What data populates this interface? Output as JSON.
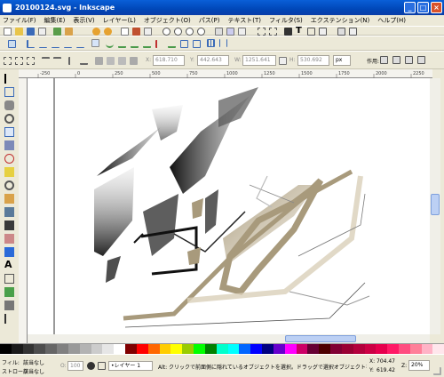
{
  "window": {
    "title": "20100124.svg - Inkscape",
    "buttons": [
      "_",
      "□",
      "×"
    ]
  },
  "menu": [
    "ファイル(F)",
    "編集(E)",
    "表示(V)",
    "レイヤー(L)",
    "オブジェクト(O)",
    "パス(P)",
    "テキスト(T)",
    "フィルタ(S)",
    "エクステンション(N)",
    "ヘルプ(H)"
  ],
  "controls": {
    "x_label": "X:",
    "x_value": "618.710",
    "y_label": "Y:",
    "y_value": "442.643",
    "w_label": "W:",
    "w_value": "1251.641",
    "h_label": "H:",
    "h_value": "530.692",
    "unit": "px",
    "affect_label": "作用:"
  },
  "status": {
    "fill_label": "フィル:",
    "fill_value": "該当なし",
    "stroke_label": "ストローク:",
    "stroke_value": "該当なし",
    "opacity_label": "O:",
    "opacity_value": "100",
    "layer": "•レイヤー 1",
    "message": "Alt: クリックで前面側に隠れているオブジェクトを選択。ドラッグで選択オブジェクトを移動または軸…",
    "cursor_x_label": "X:",
    "cursor_x": "704.47",
    "cursor_y_label": "Y:",
    "cursor_y": "619.42",
    "zoom_label": "Z:",
    "zoom": "20%"
  },
  "ruler_ticks": [
    "-250",
    "0",
    "250",
    "500",
    "750",
    "1000",
    "1250",
    "1500",
    "1750",
    "2000",
    "2250"
  ],
  "palette": [
    "#000000",
    "#1a1a1a",
    "#333333",
    "#4d4d4d",
    "#666666",
    "#808080",
    "#999999",
    "#b3b3b3",
    "#cccccc",
    "#e6e6e6",
    "#ffffff",
    "#800000",
    "#ff0000",
    "#ff6600",
    "#ffcc00",
    "#ffff00",
    "#99cc00",
    "#00ff00",
    "#008000",
    "#00ffcc",
    "#00ffff",
    "#0066ff",
    "#0000ff",
    "#000080",
    "#6600cc",
    "#ff00ff",
    "#cc0066",
    "#660033",
    "#4d0000",
    "#800033",
    "#990033",
    "#b3003c",
    "#cc0044",
    "#e6004d",
    "#ff1a66",
    "#ff4d80",
    "#ff8099",
    "#ffb3c6",
    "#ffe6ec"
  ],
  "colors": {
    "tan": "#a89a7c",
    "dark": "#111111"
  }
}
